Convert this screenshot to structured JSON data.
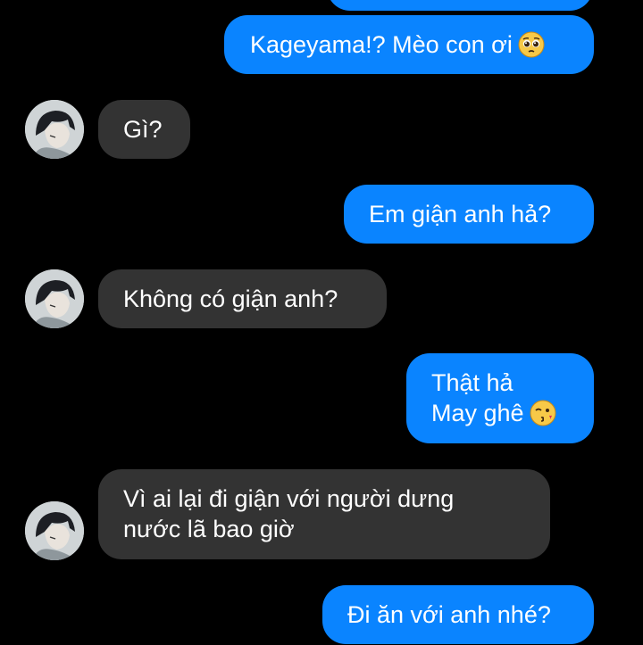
{
  "conversation": {
    "messages": [
      {
        "sender": "me",
        "text": ""
      },
      {
        "sender": "me",
        "text": "Kageyama!? Mèo con ơi",
        "emoji": "pleading-face-icon"
      },
      {
        "sender": "them",
        "text": "Gì?"
      },
      {
        "sender": "me",
        "text": "Em giận anh hả?"
      },
      {
        "sender": "them",
        "text": "Không có giận anh?"
      },
      {
        "sender": "me",
        "lines": [
          "Thật hả",
          "May ghê"
        ],
        "emoji": "kissing-wink-face-icon"
      },
      {
        "sender": "them",
        "lines": [
          "Vì ai lại đi giận với người dưng",
          "nước lã bao giờ"
        ]
      },
      {
        "sender": "me",
        "text": "Đi ăn với anh nhé?"
      }
    ]
  },
  "colors": {
    "background": "#000000",
    "outgoing_bubble": "#0a84ff",
    "incoming_bubble": "#333333",
    "text": "#ffffff"
  }
}
